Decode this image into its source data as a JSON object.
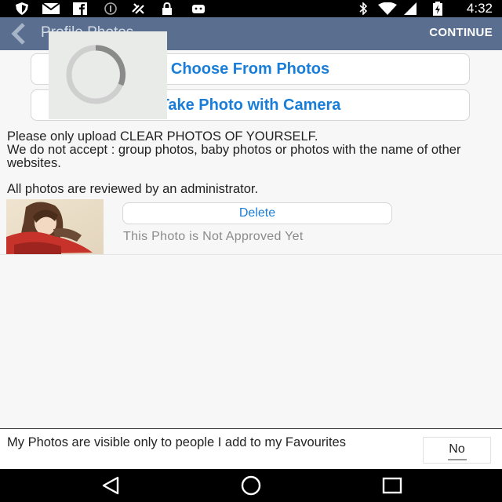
{
  "status_bar": {
    "time": "4:32",
    "icons": [
      "shield-icon",
      "mail-icon",
      "facebook-icon",
      "circle-alert-icon",
      "satellite-icon",
      "lock-icon",
      "android-icon",
      "bluetooth-icon",
      "wifi-icon",
      "battery-icon"
    ]
  },
  "app_bar": {
    "title": "Profile Photos",
    "continue_label": "CONTINUE",
    "back_icon": "chevron-left-icon"
  },
  "actions": {
    "choose_label": "Choose From Photos",
    "camera_label": "Take Photo with Camera"
  },
  "loading": {
    "icon": "spinner-icon"
  },
  "notice": {
    "line1": "Please only upload CLEAR PHOTOS OF YOURSELF.",
    "line2": "We do not accept : group photos, baby photos or photos with the name of other websites."
  },
  "review_note": "All photos are reviewed by an administrator.",
  "photo": {
    "delete_label": "Delete",
    "status": "This Photo is Not Approved Yet"
  },
  "visibility": {
    "label": "My Photos are visible only to people I add to my Favourites",
    "toggle_value": "No"
  },
  "nav_bar": {
    "icons": [
      "back-triangle-icon",
      "home-circle-icon",
      "recents-square-icon"
    ]
  },
  "colors": {
    "accent": "#1a7ed8",
    "app_bar": "#5a6f8f",
    "background": "#f7f7f7"
  }
}
